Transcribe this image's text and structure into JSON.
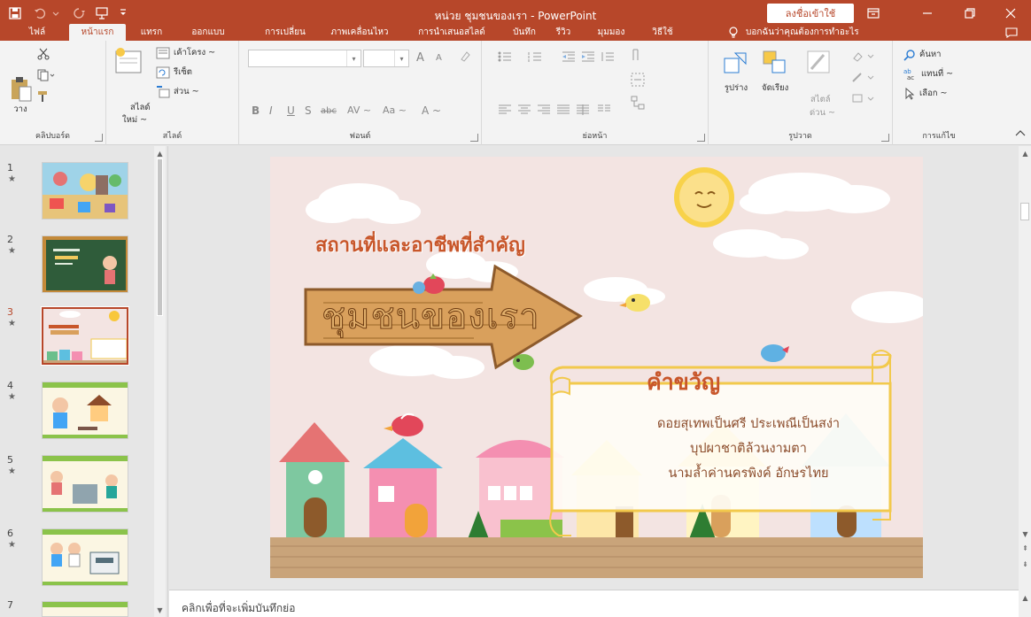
{
  "titlebar": {
    "title": "หน่วย ชุมชนของเรา  -  PowerPoint",
    "signin_label": "ลงชื่อเข้าใช้",
    "icons": [
      "save-icon",
      "undo-icon",
      "redo-icon",
      "start-from-beginning-icon",
      "customize-qat-icon"
    ]
  },
  "tabs": [
    "ไฟล์",
    "หน้าแรก",
    "แทรก",
    "ออกแบบ",
    "การเปลี่ยน",
    "ภาพเคลื่อนไหว",
    "การนำเสนอสไลด์",
    "บันทึก",
    "รีวิว",
    "มุมมอง",
    "วิธีใช้"
  ],
  "active_tab": "หน้าแรก",
  "tellme": "บอกฉันว่าคุณต้องการทำอะไร",
  "ribbon": {
    "clipboard": {
      "paste_label": "วาง",
      "group_label": "คลิปบอร์ด"
    },
    "slides": {
      "new_slide_label": "สไลด์",
      "new_slide_label2": "ใหม่ ~",
      "layout_label": "เค้าโครง ~",
      "reset_label": "รีเซ็ต",
      "section_label": "ส่วน ~",
      "group_label": "สไลด์"
    },
    "font": {
      "group_label": "ฟอนต์",
      "font_name": "",
      "font_size": "",
      "bold": "B",
      "italic": "I",
      "underline": "U",
      "shadow": "S",
      "strike": "abc",
      "spacing": "AV ~",
      "case": "Aa ~",
      "color": "A ~",
      "grow": "A",
      "shrink": "A"
    },
    "paragraph": {
      "group_label": "ย่อหน้า"
    },
    "drawing": {
      "shape_label": "รูปร่าง",
      "arrange_label": "จัดเรียง",
      "quick_styles_label": "สไตล์",
      "quick_styles_label2": "ด่วน ~",
      "group_label": "รูปวาด"
    },
    "editing": {
      "find_label": "ค้นหา",
      "replace_label": "แทนที่ ~",
      "select_label": "เลือก ~",
      "group_label": "การแก้ไข"
    }
  },
  "thumbnails": [
    {
      "num": "1",
      "star": "★"
    },
    {
      "num": "2",
      "star": "★"
    },
    {
      "num": "3",
      "star": "★"
    },
    {
      "num": "4",
      "star": "★"
    },
    {
      "num": "5",
      "star": "★"
    },
    {
      "num": "6",
      "star": "★"
    },
    {
      "num": "7",
      "star": ""
    }
  ],
  "selected_slide": "3",
  "slide": {
    "title": "สถานที่และอาชีพที่สำคัญ",
    "sign_text": "ชุมชนของเรา",
    "scroll_title": "คำขวัญ",
    "poem_lines": [
      "ดอยสุเทพเป็นศรี ประเพณีเป็นสง่า",
      "บุปผาชาติล้วนงามตา",
      "นามล้ำค่านครพิงค์ อักษรไทย"
    ]
  },
  "notes_placeholder": "คลิกเพื่อที่จะเพิ่มบันทึกย่อ",
  "colors": {
    "accent": "#b7472a",
    "ribbon": "#f3f3f3",
    "slide_bg": "#f3e4e2",
    "scroll_border": "#f2c94c",
    "title": "#c8562a"
  }
}
